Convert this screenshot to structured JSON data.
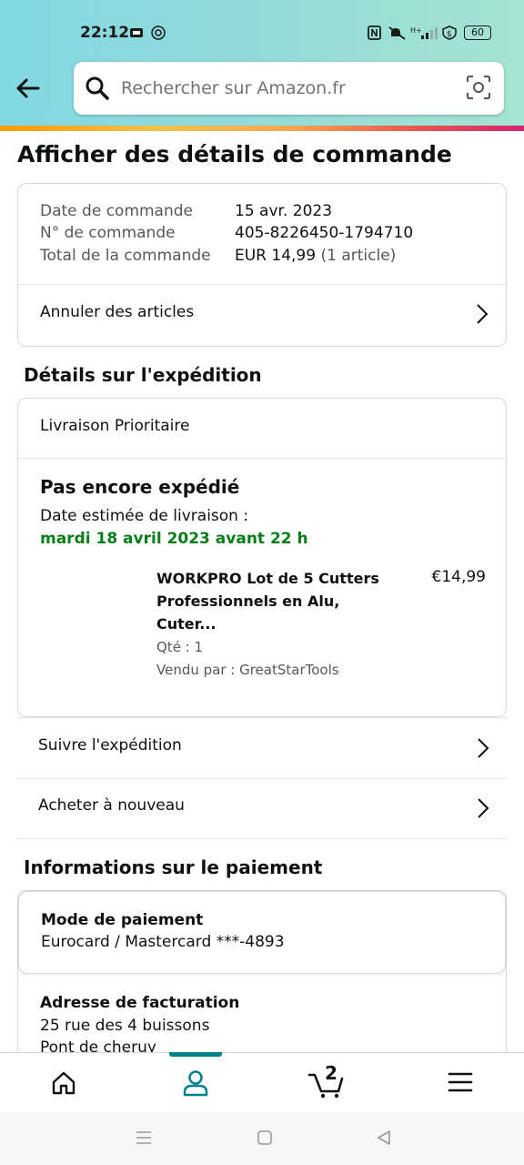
{
  "status_bar": {
    "time": "22:12",
    "battery": "60"
  },
  "search": {
    "placeholder": "Rechercher sur Amazon.fr"
  },
  "page_title": "Afficher des détails de commande",
  "order_summary": {
    "rows": [
      {
        "label": "Date de commande",
        "value": "15 avr. 2023"
      },
      {
        "label": "N° de commande",
        "value": "405-8226450-1794710"
      },
      {
        "label": "Total de la commande",
        "value": "EUR 14,99",
        "value_extra": "(1 article)"
      }
    ],
    "cancel_label": "Annuler des articles"
  },
  "shipping": {
    "heading": "Détails sur l'expédition",
    "delivery_type": "Livraison Prioritaire",
    "status": "Pas encore expédié",
    "estimate_label": "Date estimée de livraison :",
    "estimate_date": "mardi 18 avril 2023 avant 22 h",
    "estimate_color": "#067d19",
    "item": {
      "title_line1": "WORKPRO Lot de 5 Cutters",
      "title_line2": "Professionnels en Alu,",
      "title_line3": "Cuter...",
      "price": "€14,99",
      "qty": "Qté : 1",
      "seller": "Vendu par : GreatStarTools"
    },
    "track_label": "Suivre l'expédition",
    "buy_again_label": "Acheter à nouveau"
  },
  "payment": {
    "heading": "Informations sur le paiement",
    "method_title": "Mode de paiement",
    "method_value": "Eurocard / Mastercard  ***-4893",
    "billing_title": "Adresse de facturation",
    "billing_line1": "25 rue des 4 buissons",
    "billing_line2": "Pont de cheruy"
  },
  "tabbar": {
    "cart_count": "2",
    "active_color": "#00808a"
  },
  "icons": [
    "back-arrow-icon",
    "search-icon",
    "camera-icon",
    "chevron-right-icon",
    "home-icon",
    "account-icon",
    "cart-icon",
    "menu-icon"
  ]
}
